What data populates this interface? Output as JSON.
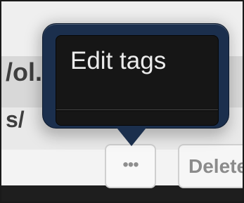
{
  "background": {
    "title_fragment": "/ol.1",
    "path_fragment": "s/"
  },
  "row_actions": {
    "more_label": "•••",
    "delete_label": "Delete"
  },
  "popover": {
    "items": [
      {
        "label": "Edit tags"
      }
    ]
  },
  "colors": {
    "popover_frame": "#1b2f4d",
    "popover_body": "#161616",
    "menu_text": "#ececec"
  }
}
